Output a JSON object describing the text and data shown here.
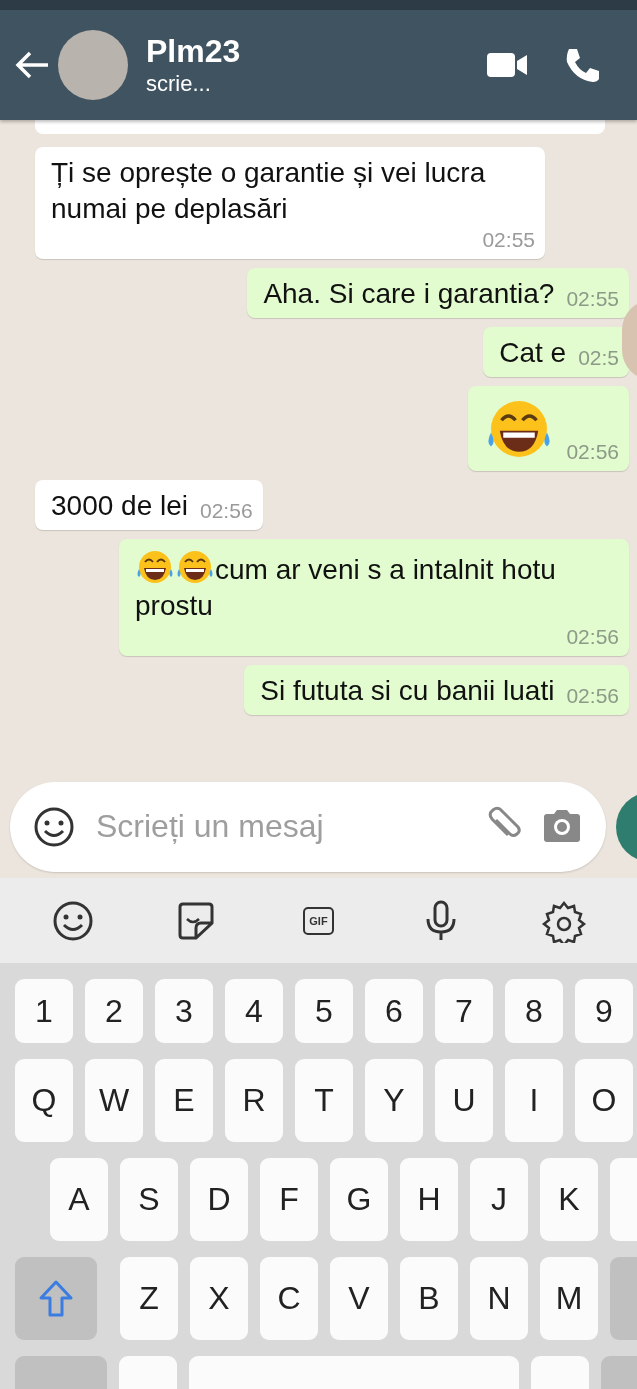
{
  "header": {
    "contact_name": "Plm23",
    "status": "scrie..."
  },
  "messages": [
    {
      "kind": "incoming",
      "text": "Ți se oprește o garantie și vei lucra numai pe deplasări",
      "time": "02:55"
    },
    {
      "kind": "outgoing",
      "text": "Aha. Si care i garantia?",
      "time": "02:55"
    },
    {
      "kind": "outgoing",
      "text": "Cat e",
      "time": "02:5"
    },
    {
      "kind": "outgoing",
      "emojis": [
        {
          "kind": "tears-of-joy"
        }
      ],
      "time": "02:56"
    },
    {
      "kind": "incoming",
      "text": "3000 de lei",
      "time": "02:56"
    },
    {
      "kind": "outgoing",
      "emojis": [
        {
          "kind": "tears-of-joy"
        },
        {
          "kind": "tears-of-joy"
        }
      ],
      "text": "cum ar veni s a intalnit hotu prostu",
      "time": "02:56"
    },
    {
      "kind": "outgoing",
      "text": "Si fututa si cu banii luati",
      "time": "02:56"
    }
  ],
  "composer": {
    "placeholder": "Scrieți un mesaj"
  },
  "keyboard_toolbar": [
    {
      "kind": "emoji"
    },
    {
      "kind": "sticker"
    },
    {
      "kind": "gif",
      "label": "GIF"
    },
    {
      "kind": "mic"
    },
    {
      "kind": "settings"
    }
  ],
  "keyboard": {
    "rows": [
      [
        "1",
        "2",
        "3",
        "4",
        "5",
        "6",
        "7",
        "8",
        "9"
      ],
      [
        "Q",
        "W",
        "E",
        "R",
        "T",
        "Y",
        "U",
        "I",
        "O"
      ],
      [
        "A",
        "S",
        "D",
        "F",
        "G",
        "H",
        "J",
        "K"
      ],
      [
        "Z",
        "X",
        "C",
        "V",
        "B",
        "N",
        "M"
      ]
    ]
  }
}
